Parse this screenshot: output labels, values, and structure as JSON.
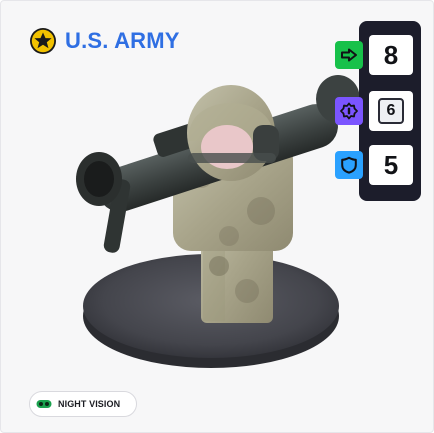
{
  "faction": {
    "name": "U.S. ARMY",
    "icon": "star-badge-icon",
    "name_color": "#2f6fe3",
    "badge_color": "#f2c200"
  },
  "stats": [
    {
      "icon": "arrow-right-icon",
      "icon_bg": "#17c14a",
      "value": "8"
    },
    {
      "icon": "sun-gear-icon",
      "icon_bg": "#7b55ff",
      "value": "6"
    },
    {
      "icon": "shield-icon",
      "icon_bg": "#2aa1ff",
      "value": "5"
    }
  ],
  "ability": {
    "label": "NIGHT VISION",
    "icon": "goggles-icon",
    "icon_color": "#1aa14e"
  },
  "figure": {
    "type": "soldier-miniature",
    "colors": {
      "camo": "#b7b59e",
      "base": "#4a4b52",
      "launcher": "#3b3f3f"
    }
  }
}
